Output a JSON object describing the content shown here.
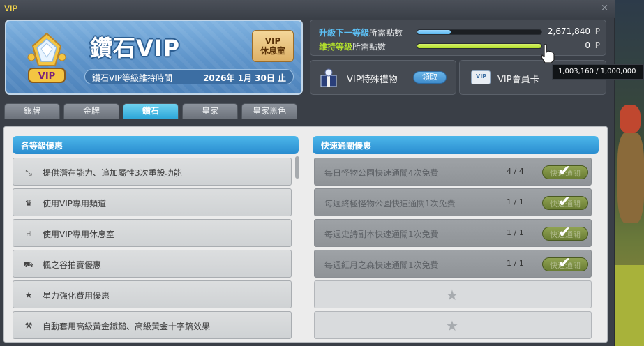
{
  "window": {
    "title": "VIP"
  },
  "banner": {
    "title": "鑽石VIP",
    "emblem_text": "VIP",
    "lounge_button": [
      "VIP",
      "休息室"
    ],
    "duration_label": "鑽石VIP等級維持時間",
    "duration_date": "2026年 1月 30日 止"
  },
  "points": {
    "upgrade": {
      "highlight": "升級下一等級",
      "rest": "所需點數",
      "value": "2,671,840",
      "unit": "P",
      "progress": 0.27,
      "color": "#5cb8f0"
    },
    "maintain": {
      "highlight": "維持等級",
      "rest": "所需點數",
      "value": "0",
      "unit": "P",
      "progress": 1.0,
      "color": "#b2e02c"
    }
  },
  "gift": {
    "label": "VIP特殊禮物",
    "claim_label": "領取"
  },
  "card": {
    "label": "VIP會員卡",
    "icon_text": "VIP"
  },
  "tooltip": "1,003,160 / 1,000,000",
  "tabs": [
    {
      "label": "銀牌",
      "active": false
    },
    {
      "label": "金牌",
      "active": false
    },
    {
      "label": "鑽石",
      "active": true
    },
    {
      "label": "皇家",
      "active": false
    },
    {
      "label": "皇家黑色",
      "active": false
    }
  ],
  "benefits_header": "各等級優惠",
  "benefits": [
    {
      "icon": "potential-reset-icon",
      "glyph": "⤡",
      "text": "提供潛在能力、追加屬性3次重設功能"
    },
    {
      "icon": "crown-icon",
      "glyph": "♛",
      "text": "使用VIP專用頻道"
    },
    {
      "icon": "chair-icon",
      "glyph": "⑁",
      "text": "使用VIP專用休息室"
    },
    {
      "icon": "cart-icon",
      "glyph": "⛟",
      "text": "楓之谷拍賣優惠"
    },
    {
      "icon": "star-icon",
      "glyph": "★",
      "text": "星力強化費用優惠"
    },
    {
      "icon": "hammer-icon",
      "glyph": "⚒",
      "text": "自動套用高級黃金鐵鎚、高級黃金十字鎬效果"
    }
  ],
  "pass_header": "快速通關優惠",
  "passes": [
    {
      "text": "每日怪物公園快速通關4次免費",
      "count": "4 / 4",
      "button": "快速通關"
    },
    {
      "text": "每週終極怪物公園快速通關1次免費",
      "count": "1 / 1",
      "button": "快速通關"
    },
    {
      "text": "每週史詩副本快速通關1次免費",
      "count": "1 / 1",
      "button": "快速通關"
    },
    {
      "text": "每週紅月之森快速通關1次免費",
      "count": "1 / 1",
      "button": "快速通關"
    }
  ],
  "empty_slots": 2,
  "colors": {
    "accent": "#2ea7d9",
    "title": "#f2d34a"
  }
}
